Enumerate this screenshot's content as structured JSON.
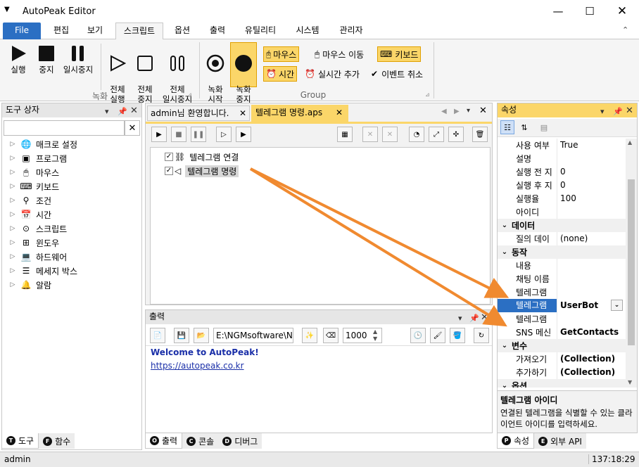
{
  "window": {
    "title": "AutoPeak Editor"
  },
  "menu": [
    "File",
    "편집",
    "보기",
    "스크립트",
    "옵션",
    "출력",
    "유틸리티",
    "시스템",
    "관리자"
  ],
  "ribbon": {
    "rec_buttons": [
      "실행",
      "중지",
      "일시중지"
    ],
    "rec_buttons2": [
      "전체\n실행",
      "전체\n중지",
      "전체\n일시중지"
    ],
    "group1_label": "녹화",
    "rec_start": "녹화\n시작",
    "rec_stop": "녹화\n중지",
    "opt_mouse_click": "마우스",
    "opt_mouse_move": "마우스 이동",
    "opt_keyboard": "키보드",
    "opt_time": "시간",
    "opt_realtime": "실시간 추가",
    "opt_cancel_event": "이벤트 취소",
    "group2_label": "Group"
  },
  "toolbox": {
    "title": "도구 상자",
    "items": [
      "매크로 설정",
      "프로그램",
      "마우스",
      "키보드",
      "조건",
      "시간",
      "스크립트",
      "윈도우",
      "하드웨어",
      "메세지 박스",
      "알람"
    ],
    "tabs": [
      "도구",
      "함수"
    ]
  },
  "editor": {
    "tabs": [
      "admin님 환영합니다.",
      "텔레그램 명령.aps"
    ],
    "nodes": [
      "텔레그램 연결",
      "텔레그램 명령"
    ]
  },
  "output": {
    "title": "출력",
    "path": "E:\\NGMsoftware\\NG",
    "count": "1000",
    "lines": [
      "Welcome to AutoPeak!",
      "https://autopeak.co.kr"
    ],
    "tabs": [
      "출력",
      "콘솔",
      "디버그"
    ]
  },
  "properties": {
    "title": "속성",
    "rows_top": [
      [
        "사용 여부",
        "True"
      ],
      [
        "설명",
        ""
      ],
      [
        "실행 전 지",
        "0"
      ],
      [
        "실행 후 지",
        "0"
      ],
      [
        "실행율",
        "100"
      ],
      [
        "아이디",
        ""
      ]
    ],
    "cat_data": "데이터",
    "rows_data": [
      [
        "질의 데이",
        "(none)"
      ]
    ],
    "cat_action": "동작",
    "rows_action": [
      [
        "내용",
        ""
      ],
      [
        "채팅 이름",
        ""
      ],
      [
        "텔레그램 ",
        ""
      ]
    ],
    "selected_row": [
      "텔레그램",
      "UserBot"
    ],
    "rows_action2": [
      [
        "텔레그램 ",
        ""
      ],
      [
        "SNS 메신",
        "GetContacts"
      ]
    ],
    "cat_var": "변수",
    "rows_var": [
      [
        "가져오기",
        "(Collection)"
      ],
      [
        "추가하기",
        "(Collection)"
      ]
    ],
    "cat_opt": "옵션",
    "desc_title": "텔레그램 아이디",
    "desc_text": "연결된 텔레그램을 식별할 수 있는 클라이언트 아이디를 입력하세요.",
    "tabs": [
      "속성",
      "외부 API"
    ]
  },
  "status": {
    "user": "admin",
    "time": "137:18:29"
  },
  "colors": {
    "accent": "#2b6fc3",
    "highlight": "#fbd669",
    "arrow": "#f08a30"
  }
}
